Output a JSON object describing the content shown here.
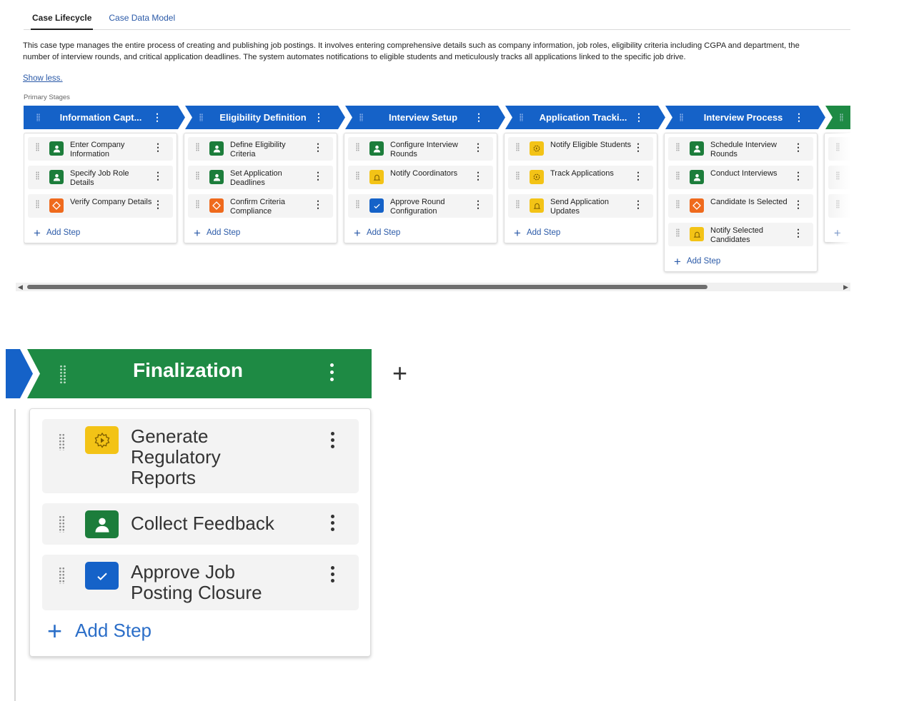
{
  "tabs": [
    {
      "label": "Case Lifecycle",
      "active": true
    },
    {
      "label": "Case Data Model",
      "active": false
    }
  ],
  "description": "This case type manages the entire process of creating and publishing job postings. It involves entering comprehensive details such as company information, job roles, eligibility criteria including CGPA and department, the number of interview rounds, and critical application deadlines. The system automates notifications to eligible students and meticulously tracks all applications linked to the specific job drive.",
  "show_less": "Show less.",
  "primary_stages_label": "Primary Stages",
  "add_step_label": "Add Step",
  "colors": {
    "stage_blue": "#1562c8",
    "stage_green": "#1e8a44",
    "icon_green": "#1c7d3b",
    "icon_orange": "#ef6a1d",
    "icon_yellow": "#f3c316",
    "icon_blue": "#1562c8",
    "link": "#2b5aa8"
  },
  "stages": [
    {
      "title": "Information Capt...",
      "color": "blue",
      "steps": [
        {
          "label": "Enter Company Information",
          "icon": "user-icon",
          "tone": "green"
        },
        {
          "label": "Specify Job Role Details",
          "icon": "user-icon",
          "tone": "green"
        },
        {
          "label": "Verify Company Details",
          "icon": "decision-icon",
          "tone": "orange"
        }
      ]
    },
    {
      "title": "Eligibility Definition",
      "color": "blue",
      "steps": [
        {
          "label": "Define Eligibility Criteria",
          "icon": "user-icon",
          "tone": "green"
        },
        {
          "label": "Set Application Deadlines",
          "icon": "user-icon",
          "tone": "green"
        },
        {
          "label": "Confirm Criteria Compliance",
          "icon": "decision-icon",
          "tone": "orange"
        }
      ]
    },
    {
      "title": "Interview Setup",
      "color": "blue",
      "steps": [
        {
          "label": "Configure Interview Rounds",
          "icon": "user-icon",
          "tone": "green"
        },
        {
          "label": "Notify Coordinators",
          "icon": "bell-icon",
          "tone": "yellow"
        },
        {
          "label": "Approve Round Configuration",
          "icon": "check-icon",
          "tone": "blue"
        }
      ]
    },
    {
      "title": "Application Tracki...",
      "color": "blue",
      "steps": [
        {
          "label": "Notify Eligible Students",
          "icon": "automation-icon",
          "tone": "yellow"
        },
        {
          "label": "Track Applications",
          "icon": "automation-icon",
          "tone": "yellow"
        },
        {
          "label": "Send Application Updates",
          "icon": "bell-icon",
          "tone": "yellow"
        }
      ]
    },
    {
      "title": "Interview Process",
      "color": "blue",
      "steps": [
        {
          "label": "Schedule Interview Rounds",
          "icon": "user-icon",
          "tone": "green"
        },
        {
          "label": "Conduct Interviews",
          "icon": "user-icon",
          "tone": "green"
        },
        {
          "label": "Candidate Is Selected",
          "icon": "decision-icon",
          "tone": "orange"
        },
        {
          "label": "Notify Selected Candidates",
          "icon": "bell-icon",
          "tone": "yellow"
        }
      ]
    }
  ],
  "zoom": {
    "stage_title": "Finalization",
    "steps": [
      {
        "label": "Generate Regulatory Reports",
        "icon": "automation-icon",
        "tone": "yellow"
      },
      {
        "label": "Collect Feedback",
        "icon": "user-icon",
        "tone": "green"
      },
      {
        "label": "Approve Job Posting Closure",
        "icon": "check-icon",
        "tone": "blue"
      }
    ],
    "add_stage_symbol": "+"
  }
}
